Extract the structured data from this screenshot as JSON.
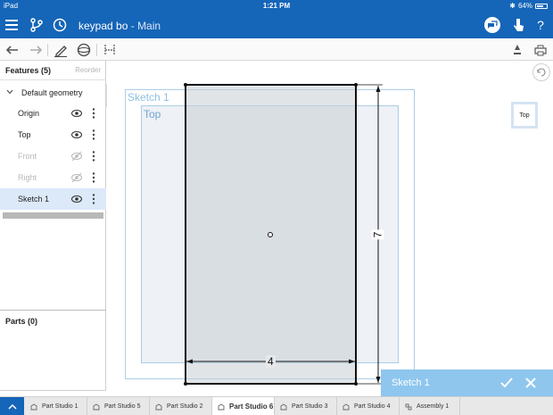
{
  "status_bar": {
    "device": "iPad",
    "time": "1:21 PM",
    "battery": "64%"
  },
  "app_bar": {
    "document_name": "keypad bo",
    "separator": " - ",
    "workspace": "Main"
  },
  "feature_panel": {
    "title": "Features (5)",
    "reorder_label": "Reorder",
    "group_label": "Default geometry",
    "items": [
      {
        "label": "Origin",
        "visible": true
      },
      {
        "label": "Top",
        "visible": true
      },
      {
        "label": "Front",
        "visible": false
      },
      {
        "label": "Right",
        "visible": false
      },
      {
        "label": "Sketch 1",
        "visible": true,
        "selected": true
      }
    ],
    "parts_title": "Parts (0)"
  },
  "canvas": {
    "sketch_plane_label": "Sketch 1",
    "top_plane_label": "Top",
    "view_cube_label": "Top",
    "dimension_width": "4",
    "dimension_height": "7"
  },
  "sketch_dialog": {
    "name": "Sketch 1"
  },
  "tabs": [
    {
      "label": "Part Studio 1",
      "active": false
    },
    {
      "label": "Part Studio 5",
      "active": false
    },
    {
      "label": "Part Studio 2",
      "active": false
    },
    {
      "label": "Part Studio 6",
      "active": true
    },
    {
      "label": "Part Studio 3",
      "active": false
    },
    {
      "label": "Part Studio 4",
      "active": false
    },
    {
      "label": "Assembly 1",
      "active": false
    }
  ],
  "colors": {
    "brand": "#1565b8",
    "selection": "#dbe9f8",
    "dialog": "#8ec6ee",
    "plane_edge": "#a9cde8"
  },
  "icons": {
    "app_bar": [
      "menu-icon",
      "branch-icon",
      "history-icon",
      "comments-icon",
      "touch-mode-icon",
      "help-icon"
    ],
    "toolbar": [
      "undo-icon",
      "redo-icon",
      "sketch-icon",
      "extrude-icon",
      "dimension-icon",
      "person-icon",
      "print-icon"
    ]
  }
}
